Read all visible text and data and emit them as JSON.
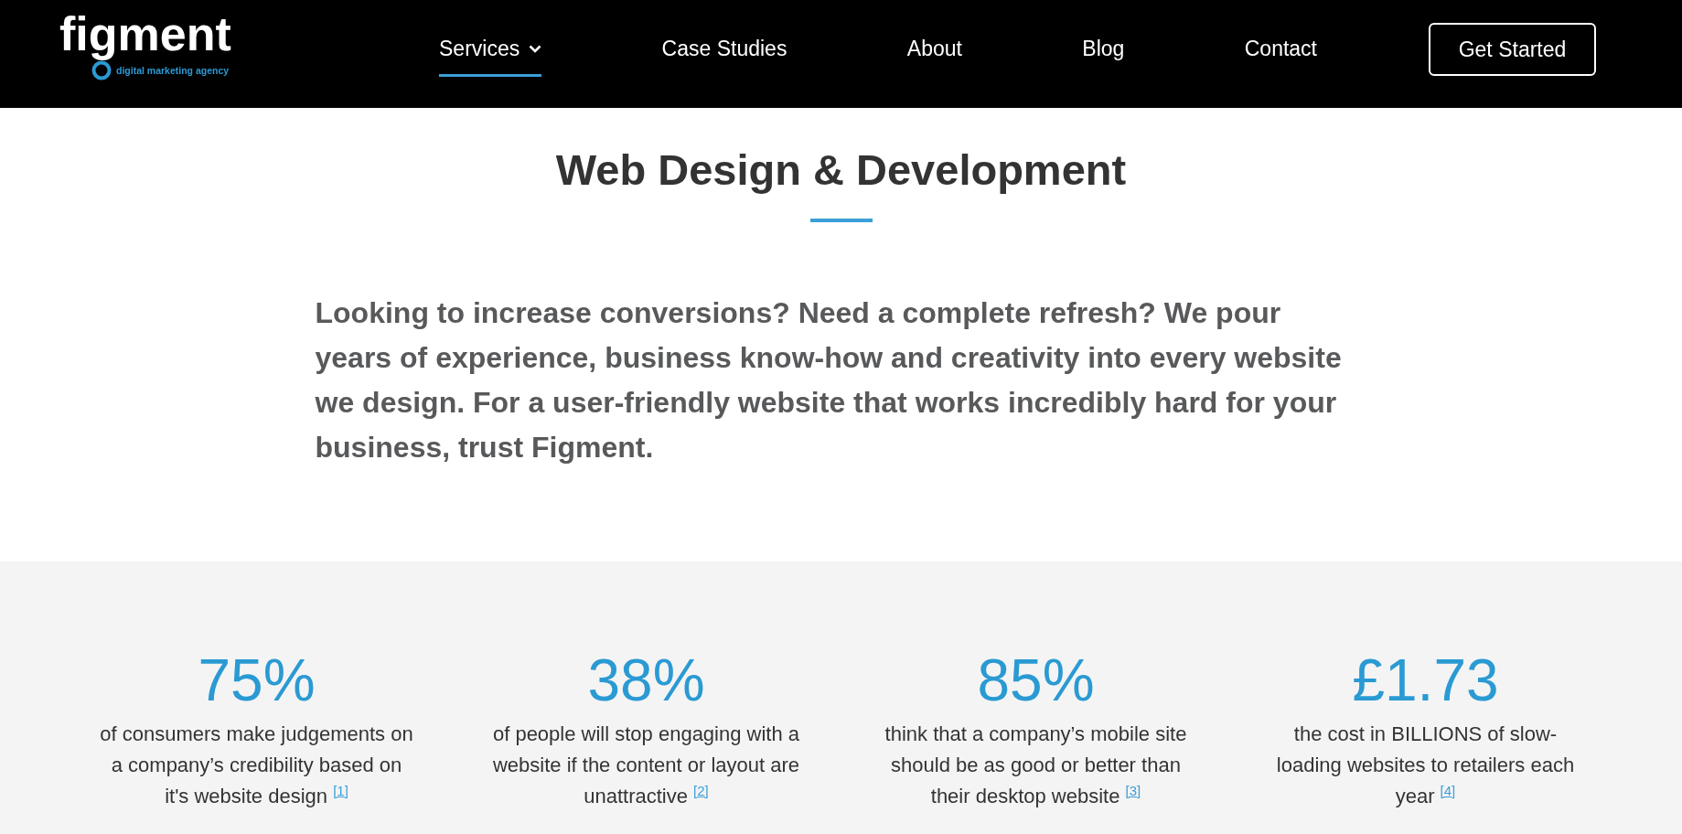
{
  "header": {
    "logo": {
      "wordmark": "figment",
      "tagline": "digital marketing agency"
    },
    "nav": [
      {
        "label": "Services",
        "selected": true,
        "dropdown": true
      },
      {
        "label": "Case Studies",
        "selected": false,
        "dropdown": false
      },
      {
        "label": "About",
        "selected": false,
        "dropdown": false
      },
      {
        "label": "Blog",
        "selected": false,
        "dropdown": false
      },
      {
        "label": "Contact",
        "selected": false,
        "dropdown": false
      }
    ],
    "cta_button": "Get Started"
  },
  "intro": {
    "title": "Web Design & Development",
    "text": "Looking to increase conversions? Need a complete refresh? We pour years of experience, business know-how and creativity into every website we design. For a user-friendly website that works incredibly hard for your business, trust Figment."
  },
  "stats": [
    {
      "value": "75%",
      "text": "of consumers make judgements on a company’s credibility based on it's website design",
      "footnote": "[1]"
    },
    {
      "value": "38%",
      "text": "of people will stop engaging with a website if the content or layout are unattractive",
      "footnote": "[2]"
    },
    {
      "value": "85%",
      "text": "think that a company’s mobile site should be as good or better than their desktop website",
      "footnote": "[3]"
    },
    {
      "value": "£1.73",
      "text": "the cost in BILLIONS of slow-loading websites to retailers each year",
      "footnote": "[4]"
    }
  ]
}
